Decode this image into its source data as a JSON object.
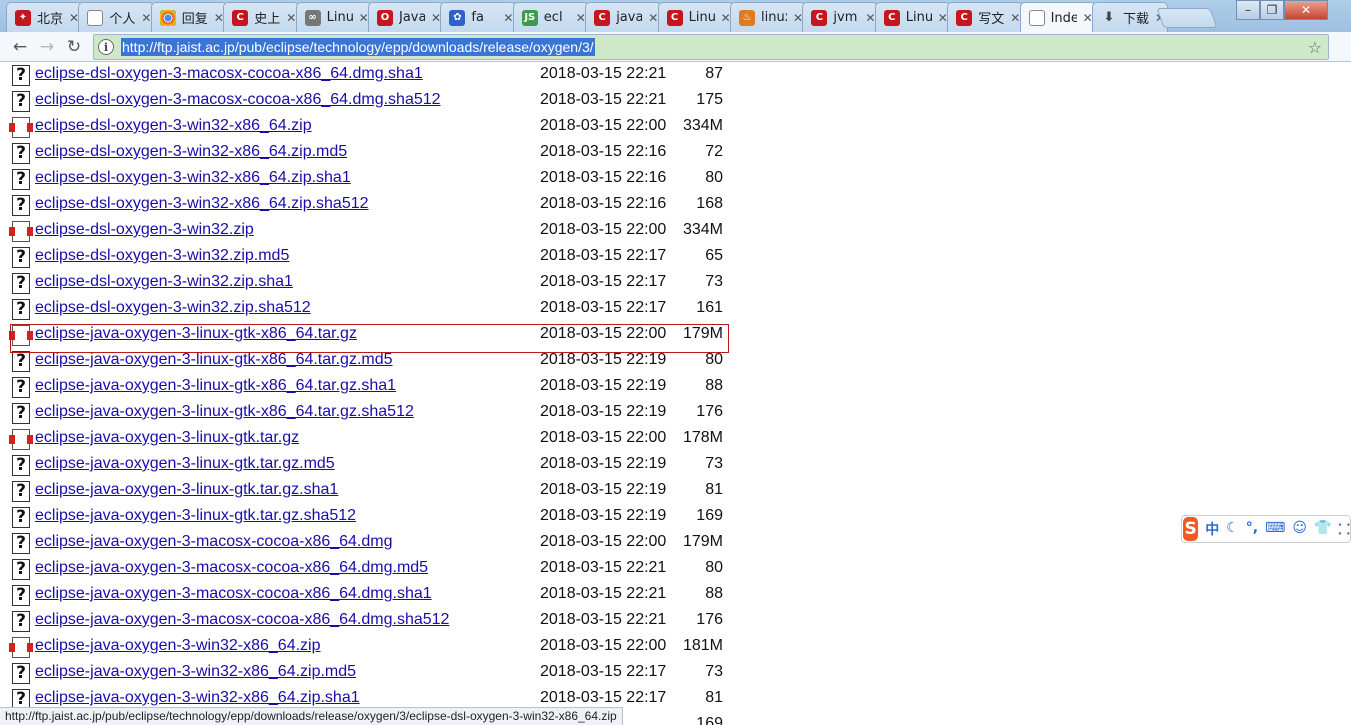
{
  "tabs": [
    {
      "title": "北京",
      "icon": "weibo-icon",
      "icon_class": "ic-red",
      "glyph": "✦"
    },
    {
      "title": "个人",
      "icon": "page-icon",
      "icon_class": "ic-doc",
      "glyph": ""
    },
    {
      "title": "回复",
      "icon": "chrome-icon",
      "icon_class": "ic-chrome",
      "glyph": ""
    },
    {
      "title": "史上",
      "icon": "csdn-icon",
      "icon_class": "ic-red",
      "glyph": "C"
    },
    {
      "title": "Linux",
      "icon": "link-icon",
      "icon_class": "ic-grey",
      "glyph": "∞"
    },
    {
      "title": "Java",
      "icon": "oracle-icon",
      "icon_class": "ic-red",
      "glyph": "O"
    },
    {
      "title": "fa",
      "icon": "baidu-paw-icon",
      "icon_class": "ic-blue",
      "glyph": "✿"
    },
    {
      "title": "ecl",
      "icon": "js-icon",
      "icon_class": "ic-green",
      "glyph": "JS"
    },
    {
      "title": "java",
      "icon": "csdn-icon",
      "icon_class": "ic-red",
      "glyph": "C"
    },
    {
      "title": "Linux",
      "icon": "csdn-icon",
      "icon_class": "ic-red",
      "glyph": "C"
    },
    {
      "title": "linux",
      "icon": "java-icon",
      "icon_class": "ic-orange",
      "glyph": "♨"
    },
    {
      "title": "jvm",
      "icon": "csdn-icon",
      "icon_class": "ic-red",
      "glyph": "C"
    },
    {
      "title": "Linux",
      "icon": "csdn-icon",
      "icon_class": "ic-red",
      "glyph": "C"
    },
    {
      "title": "写文",
      "icon": "csdn-icon",
      "icon_class": "ic-red",
      "glyph": "C"
    },
    {
      "title": "Index",
      "icon": "page-icon",
      "icon_class": "ic-doc",
      "glyph": "",
      "active": true
    },
    {
      "title": "下载",
      "icon": "download-icon",
      "icon_class": "",
      "glyph": "⬇"
    }
  ],
  "toolbar": {
    "url": "http://ftp.jaist.ac.jp/pub/eclipse/technology/epp/downloads/release/oxygen/3/"
  },
  "files": [
    {
      "name": "eclipse-dsl-oxygen-3-macosx-cocoa-x86_64.dmg.sha1",
      "date": "2018-03-15 22:21",
      "size": "87",
      "kind": "unknown"
    },
    {
      "name": "eclipse-dsl-oxygen-3-macosx-cocoa-x86_64.dmg.sha512",
      "date": "2018-03-15 22:21",
      "size": "175",
      "kind": "unknown"
    },
    {
      "name": "eclipse-dsl-oxygen-3-win32-x86_64.zip",
      "date": "2018-03-15 22:00",
      "size": "334M",
      "kind": "archive"
    },
    {
      "name": "eclipse-dsl-oxygen-3-win32-x86_64.zip.md5",
      "date": "2018-03-15 22:16",
      "size": "72",
      "kind": "unknown"
    },
    {
      "name": "eclipse-dsl-oxygen-3-win32-x86_64.zip.sha1",
      "date": "2018-03-15 22:16",
      "size": "80",
      "kind": "unknown"
    },
    {
      "name": "eclipse-dsl-oxygen-3-win32-x86_64.zip.sha512",
      "date": "2018-03-15 22:16",
      "size": "168",
      "kind": "unknown"
    },
    {
      "name": "eclipse-dsl-oxygen-3-win32.zip",
      "date": "2018-03-15 22:00",
      "size": "334M",
      "kind": "archive"
    },
    {
      "name": "eclipse-dsl-oxygen-3-win32.zip.md5",
      "date": "2018-03-15 22:17",
      "size": "65",
      "kind": "unknown"
    },
    {
      "name": "eclipse-dsl-oxygen-3-win32.zip.sha1",
      "date": "2018-03-15 22:17",
      "size": "73",
      "kind": "unknown"
    },
    {
      "name": "eclipse-dsl-oxygen-3-win32.zip.sha512",
      "date": "2018-03-15 22:17",
      "size": "161",
      "kind": "unknown"
    },
    {
      "name": "eclipse-java-oxygen-3-linux-gtk-x86_64.tar.gz",
      "date": "2018-03-15 22:00",
      "size": "179M",
      "kind": "archive"
    },
    {
      "name": "eclipse-java-oxygen-3-linux-gtk-x86_64.tar.gz.md5",
      "date": "2018-03-15 22:19",
      "size": "80",
      "kind": "unknown"
    },
    {
      "name": "eclipse-java-oxygen-3-linux-gtk-x86_64.tar.gz.sha1",
      "date": "2018-03-15 22:19",
      "size": "88",
      "kind": "unknown"
    },
    {
      "name": "eclipse-java-oxygen-3-linux-gtk-x86_64.tar.gz.sha512",
      "date": "2018-03-15 22:19",
      "size": "176",
      "kind": "unknown"
    },
    {
      "name": "eclipse-java-oxygen-3-linux-gtk.tar.gz",
      "date": "2018-03-15 22:00",
      "size": "178M",
      "kind": "archive"
    },
    {
      "name": "eclipse-java-oxygen-3-linux-gtk.tar.gz.md5",
      "date": "2018-03-15 22:19",
      "size": "73",
      "kind": "unknown"
    },
    {
      "name": "eclipse-java-oxygen-3-linux-gtk.tar.gz.sha1",
      "date": "2018-03-15 22:19",
      "size": "81",
      "kind": "unknown"
    },
    {
      "name": "eclipse-java-oxygen-3-linux-gtk.tar.gz.sha512",
      "date": "2018-03-15 22:19",
      "size": "169",
      "kind": "unknown"
    },
    {
      "name": "eclipse-java-oxygen-3-macosx-cocoa-x86_64.dmg",
      "date": "2018-03-15 22:00",
      "size": "179M",
      "kind": "unknown"
    },
    {
      "name": "eclipse-java-oxygen-3-macosx-cocoa-x86_64.dmg.md5",
      "date": "2018-03-15 22:21",
      "size": "80",
      "kind": "unknown"
    },
    {
      "name": "eclipse-java-oxygen-3-macosx-cocoa-x86_64.dmg.sha1",
      "date": "2018-03-15 22:21",
      "size": "88",
      "kind": "unknown"
    },
    {
      "name": "eclipse-java-oxygen-3-macosx-cocoa-x86_64.dmg.sha512",
      "date": "2018-03-15 22:21",
      "size": "176",
      "kind": "unknown"
    },
    {
      "name": "eclipse-java-oxygen-3-win32-x86_64.zip",
      "date": "2018-03-15 22:00",
      "size": "181M",
      "kind": "archive"
    },
    {
      "name": "eclipse-java-oxygen-3-win32-x86_64.zip.md5",
      "date": "2018-03-15 22:17",
      "size": "73",
      "kind": "unknown"
    },
    {
      "name": "eclipse-java-oxygen-3-win32-x86_64.zip.sha1",
      "date": "2018-03-15 22:17",
      "size": "81",
      "kind": "unknown"
    },
    {
      "name": "",
      "date": "",
      "size": "169",
      "kind": "unknown"
    }
  ],
  "highlight_index": 10,
  "ime": {
    "lang": "中",
    "items": [
      "☾",
      "°,",
      "⌨",
      "☺",
      "👕",
      "⸬"
    ]
  },
  "status_text": "http://ftp.jaist.ac.jp/pub/eclipse/technology/epp/downloads/release/oxygen/3/eclipse-dsl-oxygen-3-win32-x86_64.zip",
  "colors": {
    "link": "#1a0dab",
    "highlight_border": "#c01818",
    "url_selection": "#3875d7",
    "omnibox_bg": "#cfe8c8"
  }
}
